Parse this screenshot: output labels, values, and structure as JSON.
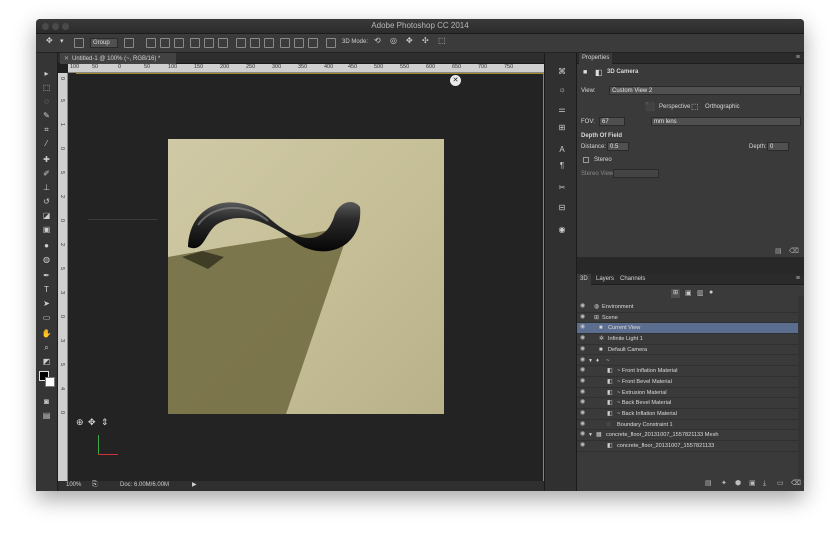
{
  "app": {
    "title": "Adobe Photoshop CC 2014"
  },
  "options_bar": {
    "group_select": "Group",
    "mode_label": "3D Mode:"
  },
  "document": {
    "tab_label": "Untitled-1 @ 100% (~, RGB/16) *",
    "zoom": "100%",
    "doc_info": "Doc: 6.00M/6.00M"
  },
  "ruler": {
    "top": [
      "100",
      "50",
      "0",
      "50",
      "100",
      "150",
      "200",
      "250",
      "300",
      "350",
      "400",
      "450",
      "500",
      "550",
      "600",
      "650",
      "700",
      "750",
      "800",
      "850",
      "900",
      "950",
      "1000",
      "1100",
      "1200",
      "1300"
    ],
    "left": [
      "0",
      "5",
      "1",
      "0",
      "5",
      "2",
      "0",
      "2",
      "5",
      "3",
      "0",
      "3",
      "5",
      "4",
      "0",
      "4",
      "5",
      "5",
      "0"
    ]
  },
  "properties": {
    "tab": "Properties",
    "section_title": "3D Camera",
    "view_label": "View:",
    "view_value": "Custom View 2",
    "perspective_label": "Perspective",
    "orthographic_label": "Orthographic",
    "fov_label": "FOV:",
    "fov_value": "67",
    "lens_value": "mm lens",
    "dof_title": "Depth Of Field",
    "distance_label": "Distance:",
    "distance_value": "0.5",
    "depth_label": "Depth:",
    "depth_value": "0",
    "stereo_label": "Stereo",
    "stereo_view_label": "Stereo View:"
  },
  "panel3d": {
    "tabs": [
      "3D",
      "Layers",
      "Channels"
    ],
    "rows": [
      {
        "label": "Environment",
        "indent": 0,
        "icon": "globe-icon"
      },
      {
        "label": "Scene",
        "indent": 0,
        "icon": "scene-icon"
      },
      {
        "label": "Current View",
        "indent": 1,
        "icon": "camera-icon",
        "selected": true
      },
      {
        "label": "Infinite Light 1",
        "indent": 1,
        "icon": "light-icon"
      },
      {
        "label": "Default Camera",
        "indent": 1,
        "icon": "camera-icon"
      },
      {
        "label": "~",
        "indent": 1,
        "icon": "mesh-icon"
      },
      {
        "label": "~ Front Inflation Material",
        "indent": 2,
        "icon": "material-icon"
      },
      {
        "label": "~ Front Bevel Material",
        "indent": 2,
        "icon": "material-icon"
      },
      {
        "label": "~ Extrusion Material",
        "indent": 2,
        "icon": "material-icon"
      },
      {
        "label": "~ Back Bevel Material",
        "indent": 2,
        "icon": "material-icon"
      },
      {
        "label": "~ Back Inflation Material",
        "indent": 2,
        "icon": "material-icon"
      },
      {
        "label": "Boundary Constraint 1",
        "indent": 2,
        "icon": "constraint-icon"
      },
      {
        "label": "concrete_floor_20131007_1557821133 Mesh",
        "indent": 1,
        "icon": "mesh-icon"
      },
      {
        "label": "concrete_floor_20131007_1557821133",
        "indent": 2,
        "icon": "material-icon"
      }
    ]
  },
  "colors": {
    "accent_guide": "#a08a2c",
    "selection": "#5c6e8f"
  }
}
